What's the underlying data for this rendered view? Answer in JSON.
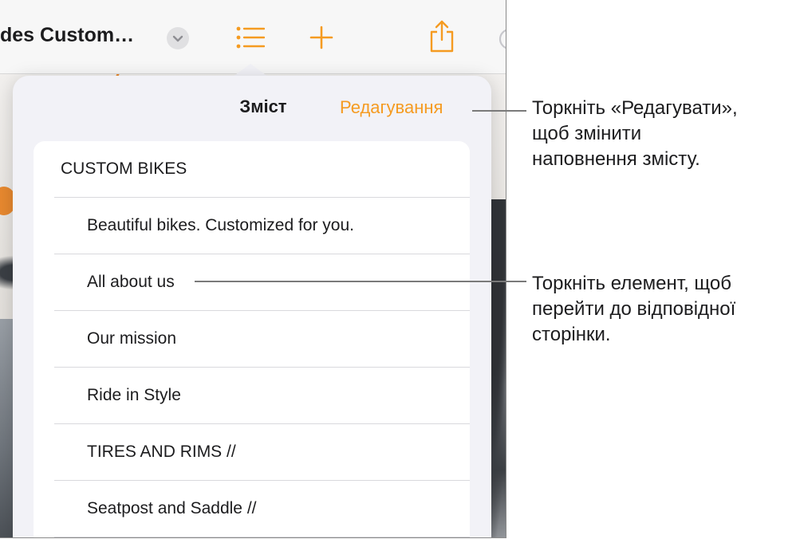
{
  "toolbar": {
    "doc_title": "des Custom…",
    "title_menu_icon": "chevron-down-icon",
    "toc_icon": "list-icon",
    "add_icon": "plus-icon",
    "share_icon": "share-icon"
  },
  "toc_popover": {
    "title": "Зміст",
    "edit_label": "Редагування",
    "items": [
      {
        "label": "CUSTOM  BIKES",
        "level": 1
      },
      {
        "label": "Beautiful bikes. Customized for you.",
        "level": 2
      },
      {
        "label": "All about us",
        "level": 2
      },
      {
        "label": "Our mission",
        "level": 2
      },
      {
        "label": "Ride in Style",
        "level": 2
      },
      {
        "label": "TIRES AND RIMS //",
        "level": 2
      },
      {
        "label": "Seatpost and Saddle //",
        "level": 2
      }
    ]
  },
  "callouts": {
    "edit": "Торкніть «Редагувати», щоб змінити наповнення змісту.",
    "edit_lines": [
      "Торкніть «Редагувати»,",
      "щоб змінити",
      "наповнення змісту."
    ],
    "item": "Торкніть елемент, щоб перейти до відповідної сторінки.",
    "item_lines": [
      "Торкніть елемент, щоб",
      "перейти до відповідної",
      "сторінки."
    ]
  },
  "colors": {
    "accent": "#f59b21",
    "text": "#1c1c1e",
    "popover_bg": "#f2f2f7"
  }
}
